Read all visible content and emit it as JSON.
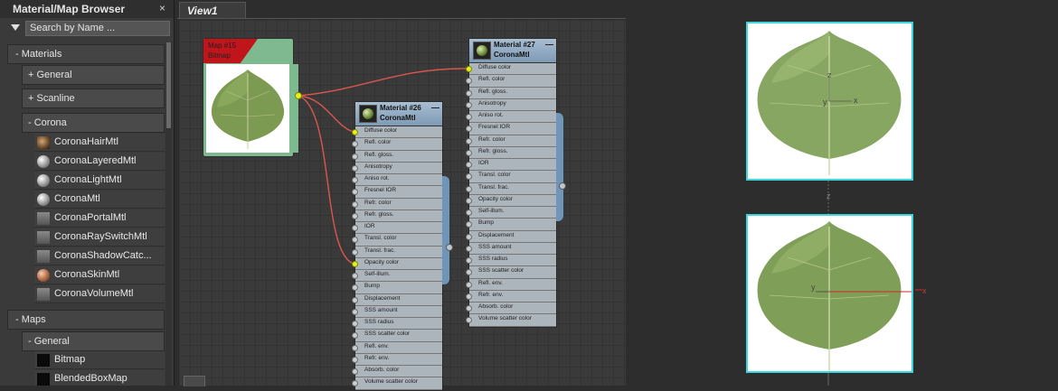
{
  "browser": {
    "title": "Material/Map Browser",
    "close_symbol": "×",
    "search_placeholder": "Search by Name ...",
    "materials_section": "- Materials",
    "general_group": "+ General",
    "scanline_group": "+ Scanline",
    "corona_group": "- Corona",
    "corona_items": [
      {
        "label": "CoronaHairMtl",
        "icon": "hair-material-icon"
      },
      {
        "label": "CoronaLayeredMtl",
        "icon": "sphere-material-icon"
      },
      {
        "label": "CoronaLightMtl",
        "icon": "sphere-material-icon"
      },
      {
        "label": "CoronaMtl",
        "icon": "sphere-material-icon"
      },
      {
        "label": "CoronaPortalMtl",
        "icon": "square-material-icon"
      },
      {
        "label": "CoronaRaySwitchMtl",
        "icon": "square-material-icon"
      },
      {
        "label": "CoronaShadowCatc...",
        "icon": "square-material-icon"
      },
      {
        "label": "CoronaSkinMtl",
        "icon": "skin-material-icon"
      },
      {
        "label": "CoronaVolumeMtl",
        "icon": "square-material-icon"
      }
    ],
    "maps_section": "- Maps",
    "maps_general_group": "- General",
    "map_items": [
      {
        "label": "Bitmap",
        "icon": "black-map-icon"
      },
      {
        "label": "BlendedBoxMap",
        "icon": "black-map-icon"
      }
    ]
  },
  "view": {
    "tab_label": "View1"
  },
  "bitmap_node": {
    "title_line1": "Map #15",
    "title_line2": "Bitmap"
  },
  "material26": {
    "title_line1": "Material #26",
    "title_line2": "CoronaMtl",
    "minimize": "—",
    "slots": [
      "Diffuse color",
      "Refl. color",
      "Refl. gloss.",
      "Anisotropy",
      "Aniso rot.",
      "Fresnel IOR",
      "Refr. color",
      "Refr. gloss.",
      "IOR",
      "Transl. color",
      "Transl. frac.",
      "Opacity color",
      "Self-illum.",
      "Bump",
      "Displacement",
      "SSS amount",
      "SSS radius",
      "SSS scatter color",
      "Refl. env.",
      "Refr. env.",
      "Absorb. color",
      "Volume scatter color"
    ]
  },
  "material27": {
    "title_line1": "Material #27",
    "title_line2": "CoronaMtl",
    "minimize": "—",
    "slots": [
      "Diffuse color",
      "Refl. color",
      "Refl. gloss.",
      "Anisotropy",
      "Aniso rot.",
      "Fresnel IOR",
      "Refr. color",
      "Refr. gloss.",
      "IOR",
      "Transl. color",
      "Transl. frac.",
      "Opacity color",
      "Self-illum.",
      "Bump",
      "Displacement",
      "SSS amount",
      "SSS radius",
      "SSS scatter color",
      "Refl. env.",
      "Refr. env.",
      "Absorb. color",
      "Volume scatter color"
    ]
  },
  "viewport": {
    "top_axes": {
      "z": "z",
      "x": "x",
      "y": "y"
    },
    "bottom_axes": {
      "z": "z",
      "x": "x",
      "y": "y"
    }
  },
  "colors": {
    "wire": "#d9574e",
    "active_socket": "#e4f21a",
    "selection_border": "#3ad7e0",
    "bitmap_header": "#c0151b",
    "material_header": "#7f9ab5"
  }
}
